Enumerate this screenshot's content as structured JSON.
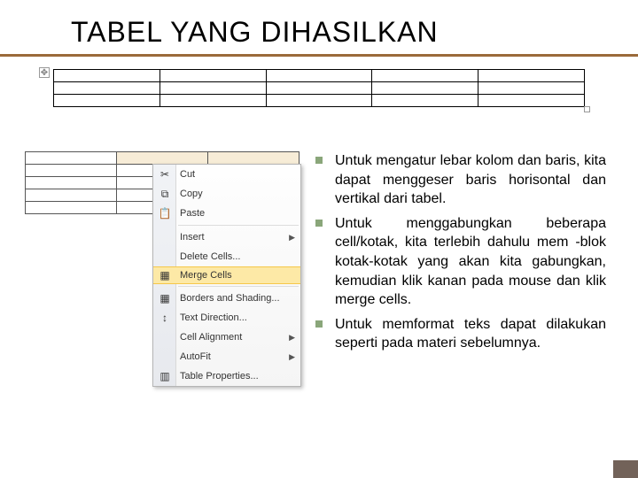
{
  "title": "TABEL YANG DIHASILKAN",
  "menu": {
    "cut": "Cut",
    "copy": "Copy",
    "paste": "Paste",
    "insert": "Insert",
    "delete_cells": "Delete Cells...",
    "merge": "Merge Cells",
    "borders": "Borders and Shading...",
    "direction": "Text Direction...",
    "align": "Cell Alignment",
    "autofit": "AutoFit",
    "props": "Table Properties..."
  },
  "icons": {
    "cut": "✂",
    "copy": "⧉",
    "paste": "📋",
    "merge": "▦",
    "borders": "▦",
    "direction": "↕",
    "props": "▥"
  },
  "bullets": [
    "Untuk mengatur lebar kolom dan baris, kita dapat menggeser baris horisontal dan vertikal dari tabel.",
    "Untuk menggabungkan beberapa cell/kotak, kita terlebih dahulu mem -blok kotak-kotak yang akan kita gabungkan, kemudian klik kanan pada mouse dan klik merge cells.",
    "Untuk memformat teks dapat dilakukan seperti pada materi sebelumnya."
  ]
}
